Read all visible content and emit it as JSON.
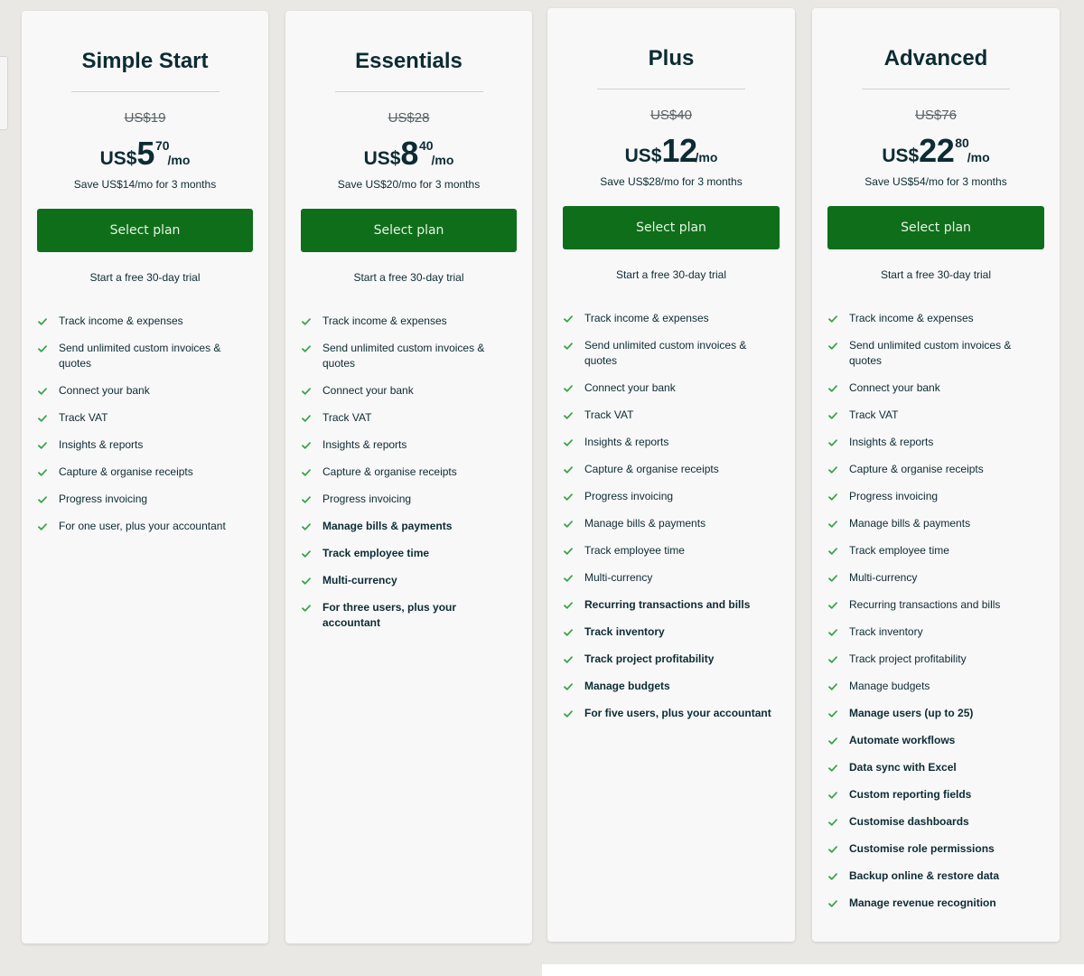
{
  "theme": {
    "button_color": "#0f6e1a",
    "check_color": "#3aa24a"
  },
  "plans": [
    {
      "name": "Simple Start",
      "old_price": "US$19",
      "currency": "US$",
      "price_int": "5",
      "price_cents": "70",
      "period": "/mo",
      "save_text": "Save US$14/mo for 3 months",
      "button_label": "Select plan",
      "trial_text": "Start a free 30-day trial",
      "features": [
        {
          "text": "Track income & expenses",
          "bold": false
        },
        {
          "text": "Send unlimited custom invoices & quotes",
          "bold": false
        },
        {
          "text": "Connect your bank",
          "bold": false
        },
        {
          "text": "Track VAT",
          "bold": false
        },
        {
          "text": "Insights & reports",
          "bold": false
        },
        {
          "text": "Capture & organise receipts",
          "bold": false
        },
        {
          "text": "Progress invoicing",
          "bold": false
        },
        {
          "text": "For one user, plus your accountant",
          "bold": false
        }
      ]
    },
    {
      "name": "Essentials",
      "old_price": "US$28",
      "currency": "US$",
      "price_int": "8",
      "price_cents": "40",
      "period": "/mo",
      "save_text": "Save US$20/mo for 3 months",
      "button_label": "Select plan",
      "trial_text": "Start a free 30-day trial",
      "features": [
        {
          "text": "Track income & expenses",
          "bold": false
        },
        {
          "text": "Send unlimited custom invoices & quotes",
          "bold": false
        },
        {
          "text": "Connect your bank",
          "bold": false
        },
        {
          "text": "Track VAT",
          "bold": false
        },
        {
          "text": "Insights & reports",
          "bold": false
        },
        {
          "text": "Capture & organise receipts",
          "bold": false
        },
        {
          "text": "Progress invoicing",
          "bold": false
        },
        {
          "text": "Manage bills & payments",
          "bold": true
        },
        {
          "text": "Track employee time",
          "bold": true
        },
        {
          "text": "Multi-currency",
          "bold": true
        },
        {
          "text": "For three users, plus your accountant",
          "bold": true
        }
      ]
    },
    {
      "name": "Plus",
      "old_price": "US$40",
      "currency": "US$",
      "price_int": "12",
      "price_cents": "",
      "period": "/mo",
      "save_text": "Save US$28/mo for 3 months",
      "button_label": "Select plan",
      "trial_text": "Start a free 30-day trial",
      "features": [
        {
          "text": "Track income & expenses",
          "bold": false
        },
        {
          "text": "Send unlimited custom invoices & quotes",
          "bold": false
        },
        {
          "text": "Connect your bank",
          "bold": false
        },
        {
          "text": "Track VAT",
          "bold": false
        },
        {
          "text": "Insights & reports",
          "bold": false
        },
        {
          "text": "Capture & organise receipts",
          "bold": false
        },
        {
          "text": "Progress invoicing",
          "bold": false
        },
        {
          "text": "Manage bills & payments",
          "bold": false
        },
        {
          "text": "Track employee time",
          "bold": false
        },
        {
          "text": "Multi-currency",
          "bold": false
        },
        {
          "text": "Recurring transactions and bills",
          "bold": true
        },
        {
          "text": "Track inventory",
          "bold": true
        },
        {
          "text": "Track project profitability",
          "bold": true
        },
        {
          "text": "Manage budgets",
          "bold": true
        },
        {
          "text": "For five users, plus your accountant",
          "bold": true
        }
      ]
    },
    {
      "name": "Advanced",
      "old_price": "US$76",
      "currency": "US$",
      "price_int": "22",
      "price_cents": "80",
      "period": "/mo",
      "save_text": "Save US$54/mo for 3 months",
      "button_label": "Select plan",
      "trial_text": "Start a free 30-day trial",
      "features": [
        {
          "text": "Track income & expenses",
          "bold": false
        },
        {
          "text": "Send unlimited custom invoices & quotes",
          "bold": false
        },
        {
          "text": "Connect your bank",
          "bold": false
        },
        {
          "text": "Track VAT",
          "bold": false
        },
        {
          "text": "Insights & reports",
          "bold": false
        },
        {
          "text": "Capture & organise receipts",
          "bold": false
        },
        {
          "text": "Progress invoicing",
          "bold": false
        },
        {
          "text": "Manage bills & payments",
          "bold": false
        },
        {
          "text": "Track employee time",
          "bold": false
        },
        {
          "text": "Multi-currency",
          "bold": false
        },
        {
          "text": "Recurring transactions and bills",
          "bold": false
        },
        {
          "text": "Track inventory",
          "bold": false
        },
        {
          "text": "Track project profitability",
          "bold": false
        },
        {
          "text": "Manage budgets",
          "bold": false
        },
        {
          "text": "Manage users (up to 25)",
          "bold": true
        },
        {
          "text": "Automate workflows",
          "bold": true
        },
        {
          "text": "Data sync with Excel",
          "bold": true
        },
        {
          "text": "Custom reporting fields",
          "bold": true
        },
        {
          "text": "Customise dashboards",
          "bold": true
        },
        {
          "text": "Customise role permissions",
          "bold": true
        },
        {
          "text": "Backup online & restore data",
          "bold": true
        },
        {
          "text": "Manage revenue recognition",
          "bold": true
        }
      ]
    }
  ]
}
